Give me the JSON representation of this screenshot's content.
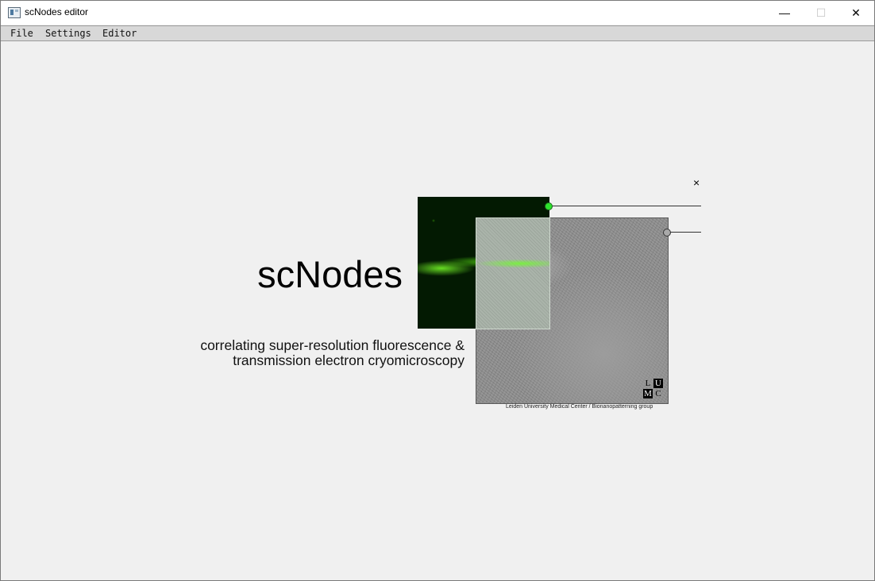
{
  "window": {
    "title": "scNodes editor",
    "controls": {
      "minimize": "—",
      "maximize": "☐",
      "close": "✕"
    }
  },
  "menu": {
    "items": [
      "File",
      "Settings",
      "Editor"
    ]
  },
  "splash": {
    "app_name": "scNodes",
    "subtitle_line1": "correlating super-resolution fluorescence &",
    "subtitle_line2": "transmission electron cryomicroscopy",
    "credit": "Leiden University Medical Center / Bionanopatterning group",
    "logo_letters": [
      "L",
      "U",
      "M",
      "C"
    ],
    "close_glyph": "×"
  },
  "colors": {
    "background": "#f0f0f0",
    "menubar": "#d8d8d8",
    "port_active": "#2de22d",
    "port_inactive": "#a9a9a9"
  },
  "icons": [
    "app-icon",
    "minimize-icon",
    "maximize-icon",
    "close-icon"
  ]
}
